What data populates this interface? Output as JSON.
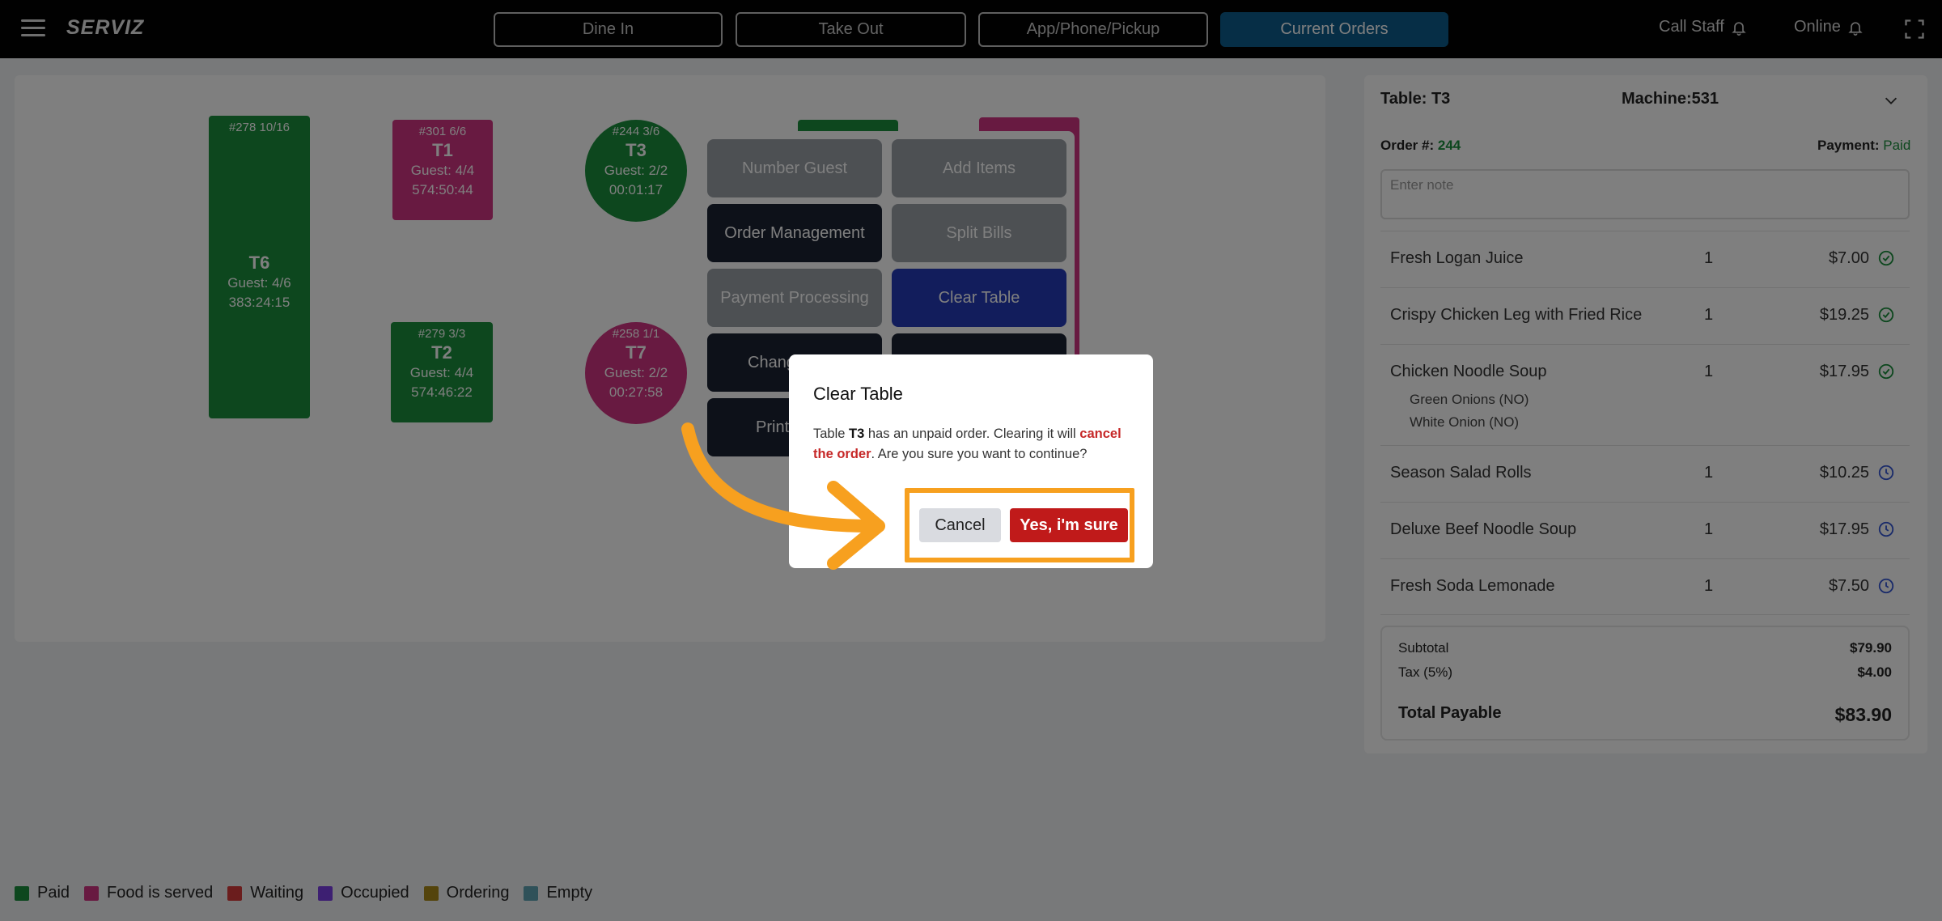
{
  "app": {
    "logo": "SERVIZ"
  },
  "nav": {
    "tabs": [
      {
        "label": "Dine In"
      },
      {
        "label": "Take Out"
      },
      {
        "label": "App/Phone/Pickup"
      },
      {
        "label": "Current Orders"
      }
    ],
    "call_staff": "Call Staff",
    "online": "Online"
  },
  "tables": [
    {
      "top": "#278  10/16",
      "name": "T6",
      "guest": "Guest: 4/6",
      "time": "383:24:15",
      "status": "Paid"
    },
    {
      "top": "#301  6/6",
      "name": "T1",
      "guest": "Guest: 4/4",
      "time": "574:50:44",
      "status": "Food is served"
    },
    {
      "top": "#244  3/6",
      "name": "T3",
      "guest": "Guest: 2/2",
      "time": "00:01:17",
      "status": "Paid"
    },
    {
      "top": "#279  3/3",
      "name": "T2",
      "guest": "Guest: 4/4",
      "time": "574:46:22",
      "status": "Paid"
    },
    {
      "top": "#258  1/1",
      "name": "T7",
      "guest": "Guest: 2/2",
      "time": "00:27:58",
      "status": "Food is served"
    }
  ],
  "context_menu": {
    "number_guest": "Number Guest",
    "add_items": "Add Items",
    "order_management": "Order Management",
    "split_bills": "Split Bills",
    "payment_processing": "Payment Processing",
    "clear_table": "Clear Table",
    "change_partial": "Chang",
    "print_partial": "Print"
  },
  "order_panel": {
    "table": "Table: T3",
    "machine": "Machine:531",
    "order_label": "Order #:",
    "order_number": "244",
    "payment_label": "Payment:",
    "payment_status": "Paid",
    "note_placeholder": "Enter note",
    "items": [
      {
        "name": "Fresh Logan Juice",
        "qty": "1",
        "price": "$7.00",
        "status": "served"
      },
      {
        "name": "Crispy Chicken Leg with Fried Rice",
        "qty": "1",
        "price": "$19.25",
        "status": "served"
      },
      {
        "name": "Chicken Noodle Soup",
        "qty": "1",
        "price": "$17.95",
        "status": "served",
        "mods": [
          "Green Onions (NO)",
          "White Onion (NO)"
        ]
      },
      {
        "name": "Season Salad Rolls",
        "qty": "1",
        "price": "$10.25",
        "status": "pending"
      },
      {
        "name": "Deluxe Beef Noodle Soup",
        "qty": "1",
        "price": "$17.95",
        "status": "pending"
      },
      {
        "name": "Fresh Soda Lemonade",
        "qty": "1",
        "price": "$7.50",
        "status": "pending"
      }
    ],
    "subtotal_label": "Subtotal",
    "subtotal": "$79.90",
    "tax_label": "Tax (5%)",
    "tax": "$4.00",
    "total_label": "Total Payable",
    "total": "$83.90"
  },
  "legend": [
    {
      "label": "Paid",
      "color": "#1a8f3c"
    },
    {
      "label": "Food is served",
      "color": "#d13582"
    },
    {
      "label": "Waiting",
      "color": "#d63a3a"
    },
    {
      "label": "Occupied",
      "color": "#7b3fe4"
    },
    {
      "label": "Ordering",
      "color": "#a98818"
    },
    {
      "label": "Empty",
      "color": "#5fa3b3"
    }
  ],
  "modal": {
    "title": "Clear Table",
    "text_1": "Table ",
    "table_name": "T3",
    "text_2": " has an unpaid order. Clearing it will ",
    "warning": "cancel the order",
    "text_3": ". Are you sure you want to continue?",
    "cancel": "Cancel",
    "confirm": "Yes, i'm sure"
  },
  "colors": {
    "accent": "#0c5d8d",
    "danger": "#c01a1a",
    "highlight": "#f7a01f"
  }
}
